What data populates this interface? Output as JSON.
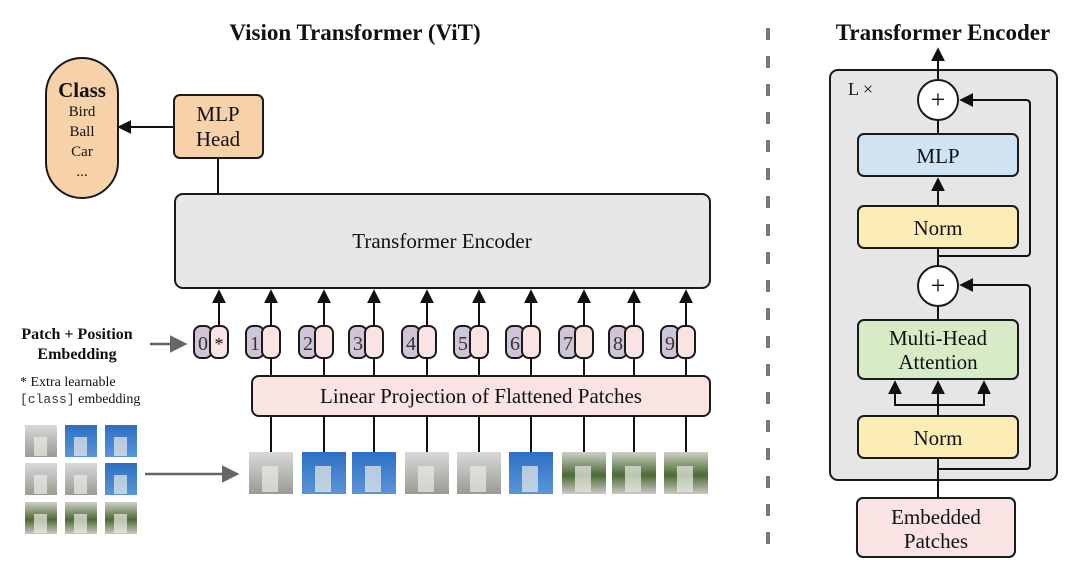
{
  "vit": {
    "title": "Vision Transformer (ViT)",
    "class_box": {
      "heading": "Class",
      "items": [
        "Bird",
        "Ball",
        "Car",
        "..."
      ]
    },
    "mlp_head": {
      "line1": "MLP",
      "line2": "Head"
    },
    "encoder_label": "Transformer Encoder",
    "embedding_label": {
      "line1": "Patch + Position",
      "line2": "Embedding"
    },
    "note": {
      "line1": "* Extra learnable",
      "code": "[class]",
      "line2_rest": " embedding"
    },
    "tokens": [
      "0",
      "1",
      "2",
      "3",
      "4",
      "5",
      "6",
      "7",
      "8",
      "9"
    ],
    "class_token_marker": "*",
    "linear_projection_label": "Linear Projection of Flattened Patches",
    "patch_count": 9,
    "grid_size": "3x3"
  },
  "encoder_detail": {
    "title": "Transformer Encoder",
    "repeat_label": "L ×",
    "blocks": {
      "mlp": "MLP",
      "norm_top": "Norm",
      "plus_symbol": "+",
      "mha_line1": "Multi-Head",
      "mha_line2": "Attention",
      "norm_bottom": "Norm",
      "embedded_line1": "Embedded",
      "embedded_line2": "Patches"
    }
  },
  "colors": {
    "orange": "#f7d2a8",
    "gray_box": "#e6e6e6",
    "pink": "#f9e3e3",
    "purple_token": "#cfc5d6",
    "blue_mlp": "#cfe3f3",
    "yellow_norm": "#fbedb5",
    "green_mha": "#d7ecc6",
    "stroke": "#1a1a1a",
    "divider": "#777777"
  }
}
